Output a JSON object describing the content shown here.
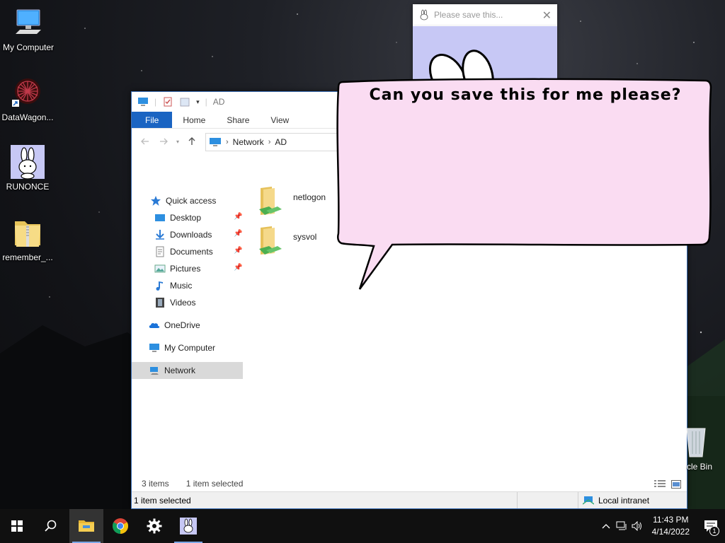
{
  "desktop": {
    "icons": [
      {
        "label": "My Computer",
        "icon": "computer-icon"
      },
      {
        "label": "DataWagon...",
        "icon": "datawagon-icon"
      },
      {
        "label": "RUNONCE",
        "icon": "rabbit-icon"
      },
      {
        "label": "remember_...",
        "icon": "zip-folder-icon"
      }
    ],
    "recycle_bin_label": "cle Bin"
  },
  "dialog": {
    "title": "Please save this...",
    "close_glyph": "✕",
    "bg_color": "#c7c8f5"
  },
  "bubble": {
    "text": "Can you save this for me please?",
    "fill": "#fadcf2"
  },
  "explorer": {
    "title": "AD",
    "ribbon_tabs": [
      "File",
      "Home",
      "Share",
      "View"
    ],
    "address": {
      "segments": [
        "Network",
        "AD"
      ]
    },
    "nav": {
      "quick_access": "Quick access",
      "pinned": [
        "Desktop",
        "Downloads",
        "Documents",
        "Pictures"
      ],
      "unpinned": [
        "Music",
        "Videos"
      ],
      "onedrive": "OneDrive",
      "my_computer": "My Computer",
      "network": "Network"
    },
    "files": [
      {
        "name": "netlogon",
        "icon": "shared-folder-icon"
      },
      {
        "name": "sysvol",
        "icon": "shared-folder-icon"
      }
    ],
    "status": {
      "count": "3 items",
      "selected": "1 item selected"
    },
    "bottom": {
      "selected": "1 item selected",
      "zone": "Local intranet"
    },
    "accent": "#1a64c2"
  },
  "taskbar": {
    "clock_time": "11:43 PM",
    "clock_date": "4/14/2022",
    "notification_count": "1",
    "apps": [
      "file-explorer-icon",
      "chrome-icon",
      "settings-icon",
      "rabbit-app-icon"
    ]
  }
}
